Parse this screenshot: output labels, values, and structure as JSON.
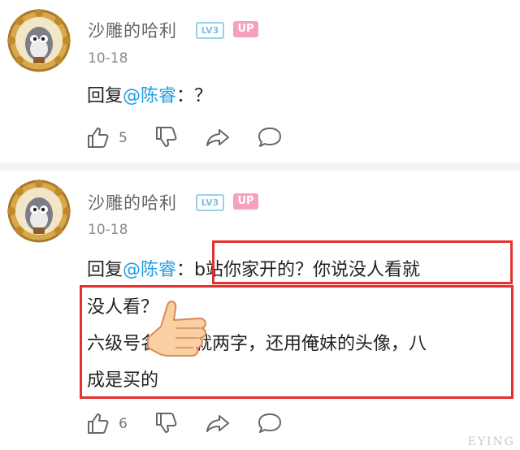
{
  "comments": [
    {
      "username": "沙雕的哈利",
      "level_badge": "LV3",
      "up_badge": "UP",
      "date": "10-18",
      "reply_prefix": "回复",
      "mention": "@陈睿",
      "text": "：？",
      "likes": "5"
    },
    {
      "username": "沙雕的哈利",
      "level_badge": "LV3",
      "up_badge": "UP",
      "date": "10-18",
      "reply_prefix": "回复",
      "mention": "@陈睿",
      "colon": "：",
      "line1": "b站你家开的？你说没人看就",
      "line2": "没人看？",
      "line3": "六级号名字还就两字，还用俺妹的头像，八",
      "line4": "成是买的",
      "likes": "6"
    }
  ],
  "watermark": "EYING",
  "colors": {
    "mention": "#1e9ee6",
    "highlight_box": "#e53030",
    "up_badge": "#f6a0bd",
    "level_badge": "#7dc2e6"
  }
}
